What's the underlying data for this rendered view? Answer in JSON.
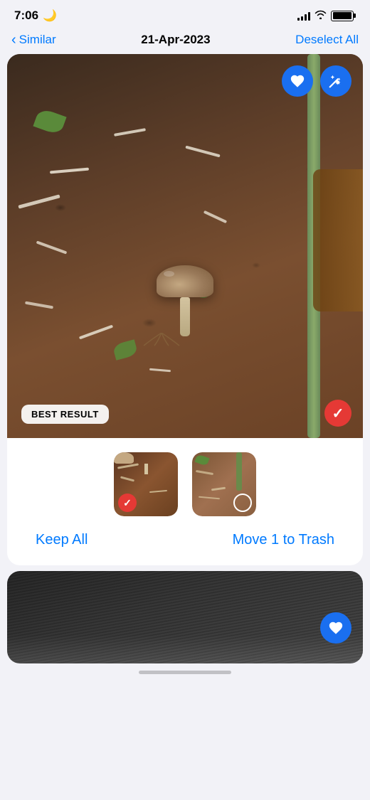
{
  "statusBar": {
    "time": "7:06",
    "moonIcon": "🌙",
    "batteryLevel": "100",
    "batteryText": "100"
  },
  "nav": {
    "backLabel": "Similar",
    "title": "21-Apr-2023",
    "actionLabel": "Deselect All"
  },
  "mainCard": {
    "bestResultLabel": "BEST RESULT",
    "heartButton": "heart",
    "magicButton": "magic-wand"
  },
  "thumbnails": {
    "thumb1Alt": "mushroom in soil selected",
    "thumb2Alt": "plant stem in soil unselected"
  },
  "actions": {
    "keepAllLabel": "Keep All",
    "moveTrashLabel": "Move 1 to Trash"
  },
  "colors": {
    "blue": "#007aff",
    "actionBlue": "#1a6ff0",
    "red": "#e53935",
    "white": "#ffffff"
  }
}
